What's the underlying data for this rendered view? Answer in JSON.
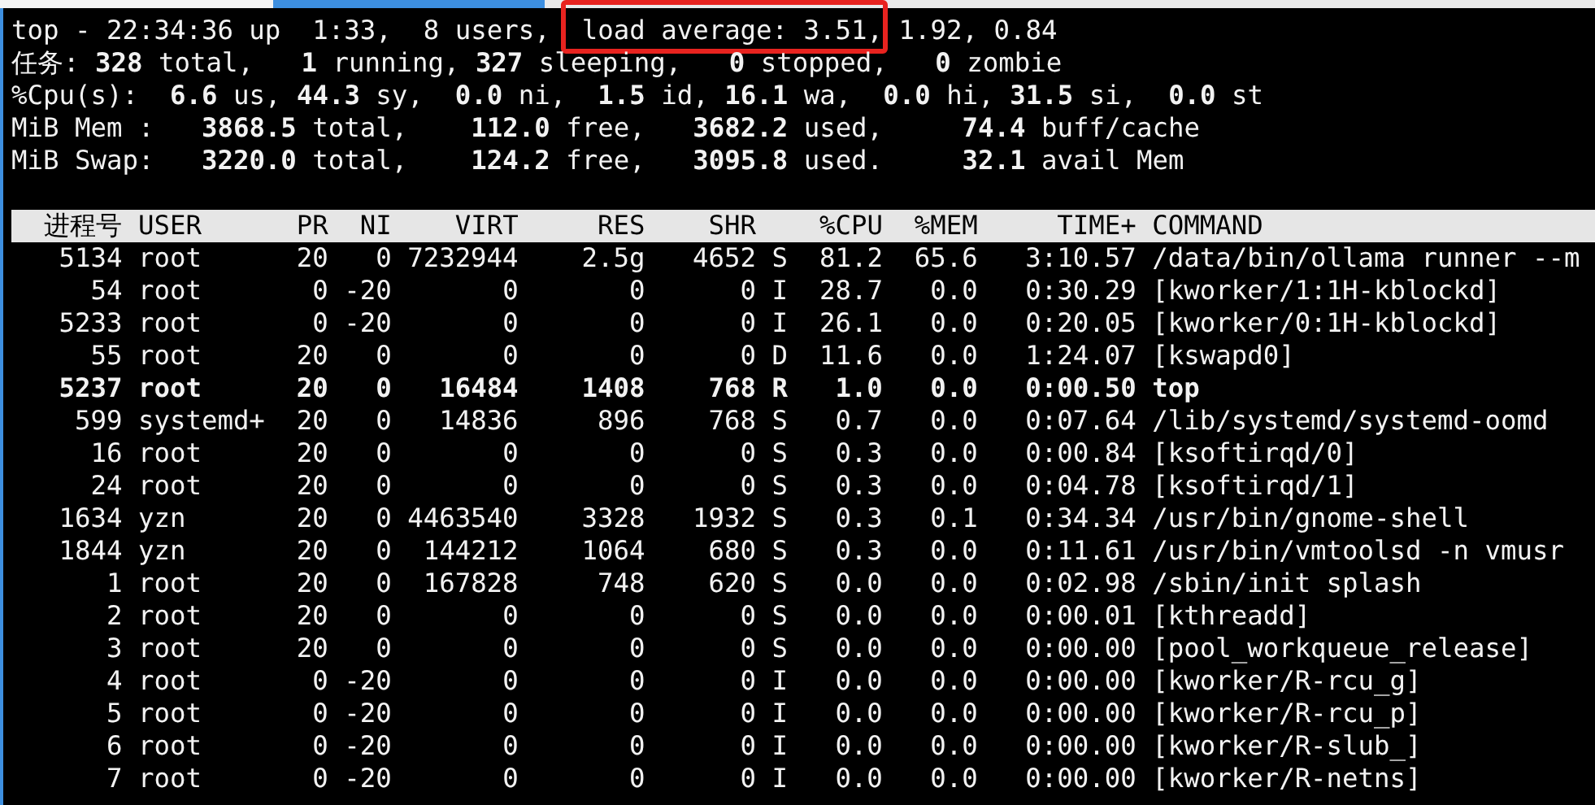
{
  "summary": [
    {
      "segments": [
        {
          "text": "top - 22:34:36 up  1:33,  8 users, ",
          "highlighted": false
        },
        {
          "text": " load average: 3.51,",
          "highlighted": true
        },
        {
          "text": " 1.92, 0.84",
          "highlighted": false
        }
      ]
    },
    {
      "segments": [
        {
          "text": "任务: **328** total,   **1** running, **327** sleeping,   **0** stopped,   **0** zombie",
          "highlighted": false
        }
      ]
    },
    {
      "segments": [
        {
          "text": "%Cpu(s):  **6.6** us, **44.3** sy,  **0.0** ni,  **1.5** id, **16.1** wa,  **0.0** hi, **31.5** si,  **0.0** st",
          "highlighted": false
        }
      ]
    },
    {
      "segments": [
        {
          "text": "MiB Mem :   **3868.5** total,    **112.0** free,   **3682.2** used,     **74.4** buff/cache",
          "highlighted": false
        }
      ]
    },
    {
      "segments": [
        {
          "text": "MiB Swap:   **3220.0** total,    **124.2** free,   **3095.8** used.     **32.1** avail Mem",
          "highlighted": false
        }
      ]
    }
  ],
  "table": {
    "header": {
      "pid": "进程号",
      "user": "USER",
      "pr": "PR",
      "ni": "NI",
      "virt": "VIRT",
      "res": "RES",
      "shr": "SHR",
      "cpu": "%CPU",
      "mem": "%MEM",
      "time": "TIME+",
      "command": "COMMAND"
    },
    "rows": [
      {
        "pid": "5134",
        "user": "root",
        "pr": "20",
        "ni": "0",
        "virt": "7232944",
        "res": "2.5g",
        "shr": "4652",
        "s": "S",
        "cpu": "81.2",
        "mem": "65.6",
        "time": "3:10.57",
        "command": "/data/bin/ollama runner --m",
        "bold": false
      },
      {
        "pid": "54",
        "user": "root",
        "pr": "0",
        "ni": "-20",
        "virt": "0",
        "res": "0",
        "shr": "0",
        "s": "I",
        "cpu": "28.7",
        "mem": "0.0",
        "time": "0:30.29",
        "command": "[kworker/1:1H-kblockd]",
        "bold": false
      },
      {
        "pid": "5233",
        "user": "root",
        "pr": "0",
        "ni": "-20",
        "virt": "0",
        "res": "0",
        "shr": "0",
        "s": "I",
        "cpu": "26.1",
        "mem": "0.0",
        "time": "0:20.05",
        "command": "[kworker/0:1H-kblockd]",
        "bold": false
      },
      {
        "pid": "55",
        "user": "root",
        "pr": "20",
        "ni": "0",
        "virt": "0",
        "res": "0",
        "shr": "0",
        "s": "D",
        "cpu": "11.6",
        "mem": "0.0",
        "time": "1:24.07",
        "command": "[kswapd0]",
        "bold": false
      },
      {
        "pid": "5237",
        "user": "root",
        "pr": "20",
        "ni": "0",
        "virt": "16484",
        "res": "1408",
        "shr": "768",
        "s": "R",
        "cpu": "1.0",
        "mem": "0.0",
        "time": "0:00.50",
        "command": "top",
        "bold": true
      },
      {
        "pid": "599",
        "user": "systemd+",
        "pr": "20",
        "ni": "0",
        "virt": "14836",
        "res": "896",
        "shr": "768",
        "s": "S",
        "cpu": "0.7",
        "mem": "0.0",
        "time": "0:07.64",
        "command": "/lib/systemd/systemd-oomd",
        "bold": false
      },
      {
        "pid": "16",
        "user": "root",
        "pr": "20",
        "ni": "0",
        "virt": "0",
        "res": "0",
        "shr": "0",
        "s": "S",
        "cpu": "0.3",
        "mem": "0.0",
        "time": "0:00.84",
        "command": "[ksoftirqd/0]",
        "bold": false
      },
      {
        "pid": "24",
        "user": "root",
        "pr": "20",
        "ni": "0",
        "virt": "0",
        "res": "0",
        "shr": "0",
        "s": "S",
        "cpu": "0.3",
        "mem": "0.0",
        "time": "0:04.78",
        "command": "[ksoftirqd/1]",
        "bold": false
      },
      {
        "pid": "1634",
        "user": "yzn",
        "pr": "20",
        "ni": "0",
        "virt": "4463540",
        "res": "3328",
        "shr": "1932",
        "s": "S",
        "cpu": "0.3",
        "mem": "0.1",
        "time": "0:34.34",
        "command": "/usr/bin/gnome-shell",
        "bold": false
      },
      {
        "pid": "1844",
        "user": "yzn",
        "pr": "20",
        "ni": "0",
        "virt": "144212",
        "res": "1064",
        "shr": "680",
        "s": "S",
        "cpu": "0.3",
        "mem": "0.0",
        "time": "0:11.61",
        "command": "/usr/bin/vmtoolsd -n vmusr",
        "bold": false
      },
      {
        "pid": "1",
        "user": "root",
        "pr": "20",
        "ni": "0",
        "virt": "167828",
        "res": "748",
        "shr": "620",
        "s": "S",
        "cpu": "0.0",
        "mem": "0.0",
        "time": "0:02.98",
        "command": "/sbin/init splash",
        "bold": false
      },
      {
        "pid": "2",
        "user": "root",
        "pr": "20",
        "ni": "0",
        "virt": "0",
        "res": "0",
        "shr": "0",
        "s": "S",
        "cpu": "0.0",
        "mem": "0.0",
        "time": "0:00.01",
        "command": "[kthreadd]",
        "bold": false
      },
      {
        "pid": "3",
        "user": "root",
        "pr": "20",
        "ni": "0",
        "virt": "0",
        "res": "0",
        "shr": "0",
        "s": "S",
        "cpu": "0.0",
        "mem": "0.0",
        "time": "0:00.00",
        "command": "[pool_workqueue_release]",
        "bold": false
      },
      {
        "pid": "4",
        "user": "root",
        "pr": "0",
        "ni": "-20",
        "virt": "0",
        "res": "0",
        "shr": "0",
        "s": "I",
        "cpu": "0.0",
        "mem": "0.0",
        "time": "0:00.00",
        "command": "[kworker/R-rcu_g]",
        "bold": false
      },
      {
        "pid": "5",
        "user": "root",
        "pr": "0",
        "ni": "-20",
        "virt": "0",
        "res": "0",
        "shr": "0",
        "s": "I",
        "cpu": "0.0",
        "mem": "0.0",
        "time": "0:00.00",
        "command": "[kworker/R-rcu_p]",
        "bold": false
      },
      {
        "pid": "6",
        "user": "root",
        "pr": "0",
        "ni": "-20",
        "virt": "0",
        "res": "0",
        "shr": "0",
        "s": "I",
        "cpu": "0.0",
        "mem": "0.0",
        "time": "0:00.00",
        "command": "[kworker/R-slub_]",
        "bold": false
      },
      {
        "pid": "7",
        "user": "root",
        "pr": "0",
        "ni": "-20",
        "virt": "0",
        "res": "0",
        "shr": "0",
        "s": "I",
        "cpu": "0.0",
        "mem": "0.0",
        "time": "0:00.00",
        "command": "[kworker/R-netns]",
        "bold": false
      }
    ]
  }
}
